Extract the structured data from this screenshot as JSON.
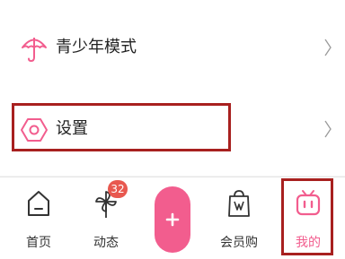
{
  "menu": {
    "items": [
      {
        "label": "青少年模式",
        "icon": "umbrella-icon"
      },
      {
        "label": "设置",
        "icon": "settings-hexagon-icon"
      }
    ]
  },
  "tabbar": {
    "tabs": [
      {
        "label": "首页",
        "icon": "home-icon"
      },
      {
        "label": "动态",
        "icon": "pinwheel-icon",
        "badge": "32"
      },
      {
        "label": "",
        "icon": "plus-icon"
      },
      {
        "label": "会员购",
        "icon": "shopping-bag-icon"
      },
      {
        "label": "我的",
        "icon": "tv-icon",
        "active": true
      }
    ]
  },
  "colors": {
    "accent": "#f25d8e",
    "highlight": "#a8201f",
    "badge": "#e8584f"
  }
}
